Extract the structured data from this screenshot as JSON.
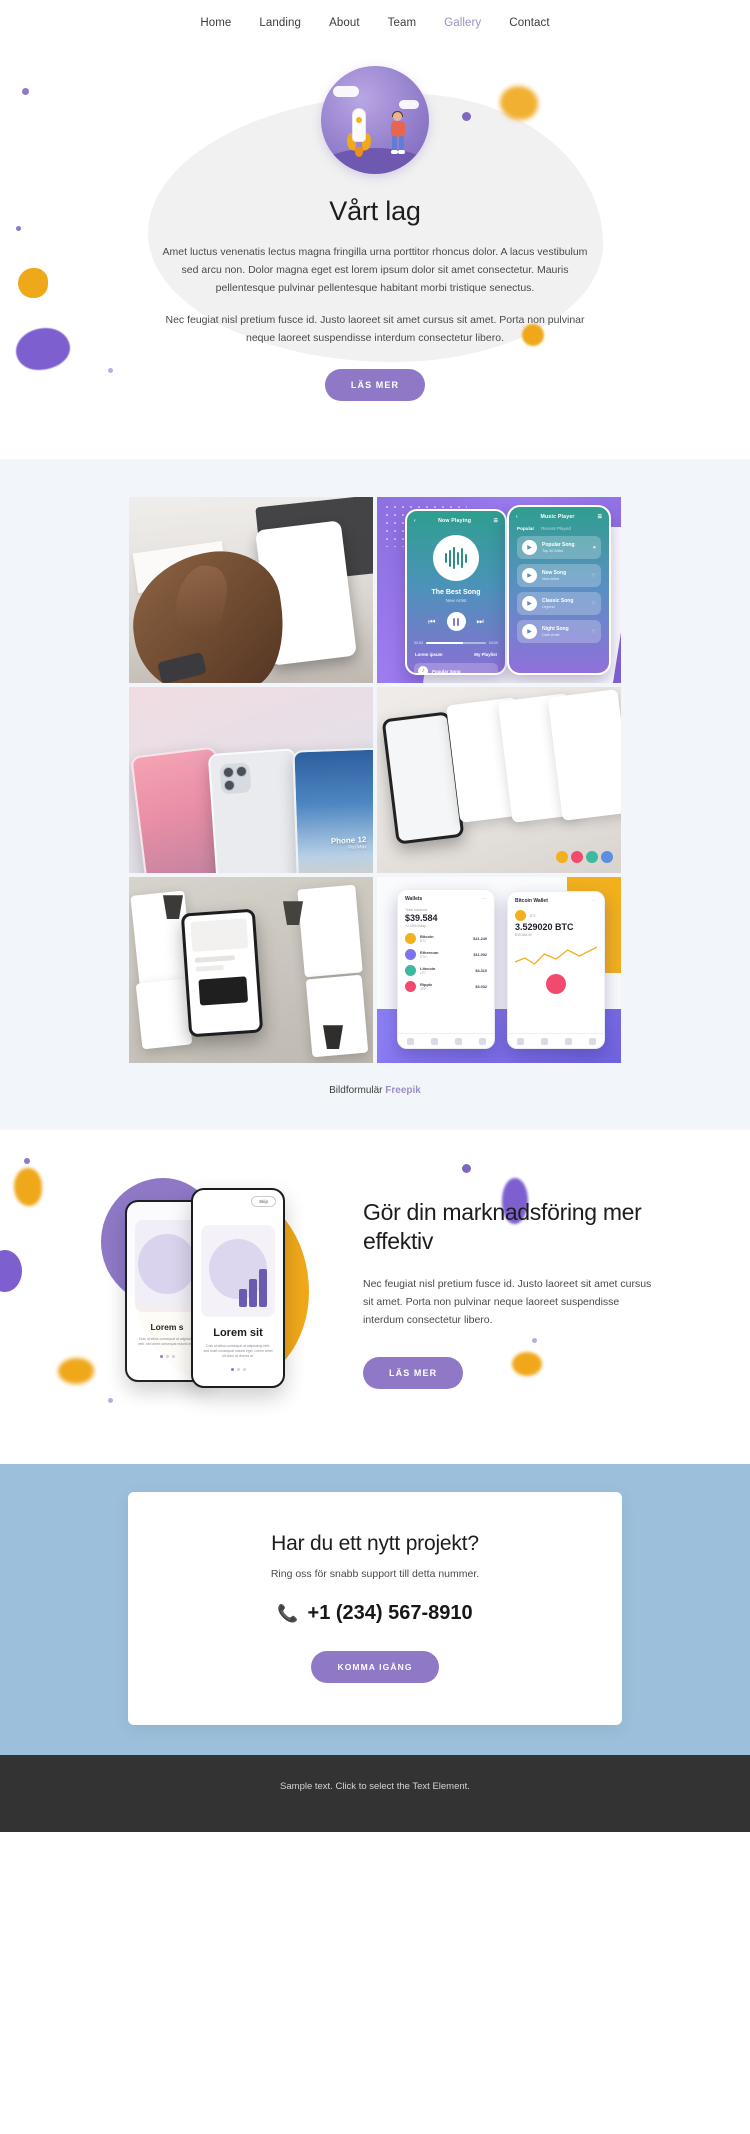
{
  "nav": {
    "items": [
      {
        "label": "Home",
        "active": false
      },
      {
        "label": "Landing",
        "active": false
      },
      {
        "label": "About",
        "active": false
      },
      {
        "label": "Team",
        "active": false
      },
      {
        "label": "Gallery",
        "active": true
      },
      {
        "label": "Contact",
        "active": false
      }
    ]
  },
  "hero": {
    "title": "Vårt lag",
    "paragraph1": "Amet luctus venenatis lectus magna fringilla urna porttitor rhoncus dolor. A lacus vestibulum sed arcu non. Dolor magna eget est lorem ipsum dolor sit amet consectetur. Mauris pellentesque pulvinar pellentesque habitant morbi tristique senectus.",
    "paragraph2": "Nec feugiat nisl pretium fusce id. Justo laoreet sit amet cursus sit amet. Porta non pulvinar neque laoreet suspendisse interdum consectetur libero.",
    "button": "LÄS MER"
  },
  "gallery": {
    "caption_text": "Bildformulär",
    "caption_link": "Freepik",
    "music_player_a": {
      "header": "Now Playing",
      "song": "The Best Song",
      "artist": "New Artist",
      "time_current": "02:03",
      "time_total": "04:09",
      "link_left": "Lorem ipsum",
      "link_right": "My Playlist",
      "now_item": "Popular Song"
    },
    "music_player_b": {
      "header": "Music Player",
      "tab_active": "Popular",
      "tab_inactive": "Recent Played",
      "songs": [
        {
          "title": "Popular Song",
          "artist": "Top 40 Artist"
        },
        {
          "title": "New Song",
          "artist": "New Artist"
        },
        {
          "title": "Classic Song",
          "artist": "Legend"
        },
        {
          "title": "Night Song",
          "artist": "Dark Artist"
        }
      ]
    },
    "phone_mockup": {
      "brand": "Phone 12",
      "model": "Pro Max"
    },
    "wallet": {
      "title_left": "Wallets",
      "title_right": "Bitcoin Wallet",
      "balance_label": "Total balance",
      "balance_left": "$39.584",
      "balance_sub_left": "+2.45% today",
      "balance_right": "3.529020 BTC",
      "balance_sub_right": "$39.584,00",
      "rows": [
        {
          "name": "Bitcoin",
          "sub": "BTC",
          "amount": "$21.240"
        },
        {
          "name": "Ethereum",
          "sub": "ETH",
          "amount": "$11.002"
        },
        {
          "name": "Litecoin",
          "sub": "LTC",
          "amount": "$4.310"
        },
        {
          "name": "Ripple",
          "sub": "XRP",
          "amount": "$3.032"
        }
      ]
    }
  },
  "marketing": {
    "title": "Gör din marknadsföring mer effektiv",
    "paragraph": "Nec feugiat nisl pretium fusce id. Justo laoreet sit amet cursus sit amet. Porta non pulvinar neque laoreet suspendisse interdum consectetur libero.",
    "button": "LÄS MER",
    "phone_back": {
      "title": "Lorem s",
      "caption": "Duis at tellus consequat at adipiscing velit, sed amet consequat mauris eget."
    },
    "phone_front": {
      "skip": "Skip",
      "title": "Lorem sit",
      "caption": "Duis at tellus consequat at adipiscing velit, sed amet consequat mauris eget. Lorem amet sit dolor at viverra at."
    }
  },
  "cta": {
    "title": "Har du ett nytt projekt?",
    "subtitle": "Ring oss för snabb support till detta nummer.",
    "phone": "+1 (234) 567-8910",
    "phone_icon": "phone-icon",
    "button": "KOMMA IGÅNG"
  },
  "footer": {
    "text": "Sample text. Click to select the Text Element."
  },
  "colors": {
    "purple": "#8f79c7",
    "orange": "#f0a81b",
    "sky": "#9cc0dc",
    "panel": "#f2f6fa",
    "footer": "#333333"
  }
}
